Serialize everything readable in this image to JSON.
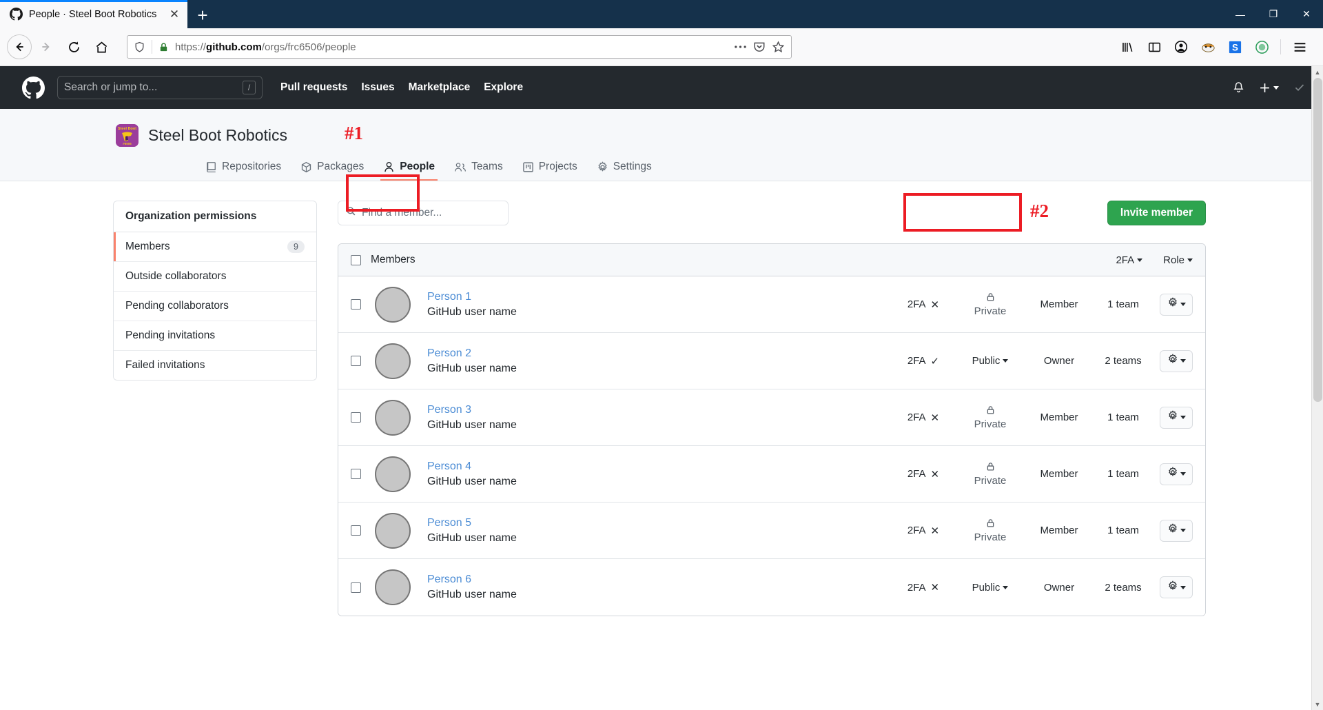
{
  "browser": {
    "tab_title": "People · Steel Boot Robotics",
    "tab_favicon": "github-icon",
    "close_label": "✕",
    "newtab_label": "+",
    "url_display": "https://github.com/orgs/frc6506/people",
    "url_prefix": "https://",
    "url_domain": "github.com",
    "url_path": "/orgs/frc6506/people",
    "window_minimize": "—",
    "window_maximize": "❐",
    "window_close": "✕"
  },
  "github_header": {
    "search_placeholder": "Search or jump to...",
    "search_shortcut": "/",
    "nav": [
      {
        "label": "Pull requests"
      },
      {
        "label": "Issues"
      },
      {
        "label": "Marketplace"
      },
      {
        "label": "Explore"
      }
    ]
  },
  "org": {
    "name": "Steel Boot Robotics",
    "avatar_alt": "org-avatar",
    "tabs": [
      {
        "label": "Repositories",
        "icon": "repo-icon",
        "selected": false
      },
      {
        "label": "Packages",
        "icon": "package-icon",
        "selected": false
      },
      {
        "label": "People",
        "icon": "person-icon",
        "selected": true
      },
      {
        "label": "Teams",
        "icon": "people-icon",
        "selected": false
      },
      {
        "label": "Projects",
        "icon": "project-icon",
        "selected": false
      },
      {
        "label": "Settings",
        "icon": "gear-icon",
        "selected": false
      }
    ]
  },
  "sidebar": {
    "heading": "Organization permissions",
    "items": [
      {
        "label": "Members",
        "count": "9",
        "active": true
      },
      {
        "label": "Outside collaborators",
        "count": "",
        "active": false
      },
      {
        "label": "Pending collaborators",
        "count": "",
        "active": false
      },
      {
        "label": "Pending invitations",
        "count": "",
        "active": false
      },
      {
        "label": "Failed invitations",
        "count": "",
        "active": false
      }
    ]
  },
  "main": {
    "find_placeholder": "Find a member...",
    "invite_label": "Invite member",
    "table_header": {
      "title": "Members",
      "twofa_label": "2FA",
      "role_label": "Role"
    },
    "rows": [
      {
        "name": "Person 1",
        "login": "GitHub user name",
        "twofa": "2FA",
        "twofa_state": "✕",
        "visibility": "Private",
        "visibility_type": "private",
        "role": "Member",
        "teams": "1 team"
      },
      {
        "name": "Person 2",
        "login": "GitHub user name",
        "twofa": "2FA",
        "twofa_state": "✓",
        "visibility": "Public",
        "visibility_type": "public",
        "role": "Owner",
        "teams": "2 teams"
      },
      {
        "name": "Person 3",
        "login": "GitHub user name",
        "twofa": "2FA",
        "twofa_state": "✕",
        "visibility": "Private",
        "visibility_type": "private",
        "role": "Member",
        "teams": "1 team"
      },
      {
        "name": "Person 4",
        "login": "GitHub user name",
        "twofa": "2FA",
        "twofa_state": "✕",
        "visibility": "Private",
        "visibility_type": "private",
        "role": "Member",
        "teams": "1 team"
      },
      {
        "name": "Person 5",
        "login": "GitHub user name",
        "twofa": "2FA",
        "twofa_state": "✕",
        "visibility": "Private",
        "visibility_type": "private",
        "role": "Member",
        "teams": "1 team"
      },
      {
        "name": "Person 6",
        "login": "GitHub user name",
        "twofa": "2FA",
        "twofa_state": "✕",
        "visibility": "Public",
        "visibility_type": "public",
        "role": "Owner",
        "teams": "2 teams"
      }
    ]
  },
  "annotations": [
    {
      "label": "#1",
      "target": "people-tab"
    },
    {
      "label": "#2",
      "target": "invite-member-button"
    }
  ],
  "colors": {
    "annotation_red": "#ec1c24",
    "invite_green": "#2ea44f",
    "tab_underline": "#f9826c",
    "link_blue": "#4a8bd4",
    "header_dark": "#24292e"
  }
}
